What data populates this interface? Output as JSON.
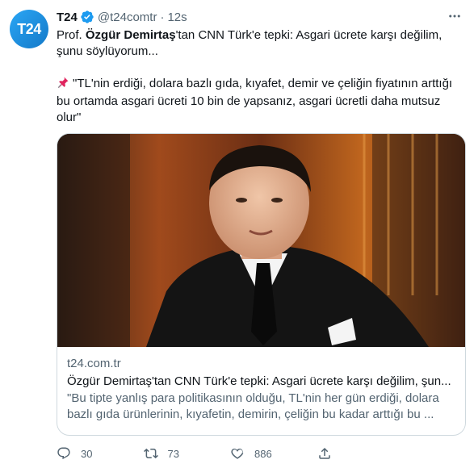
{
  "tweet": {
    "avatar_text": "T24",
    "display_name": "T24",
    "handle": "@t24comtr",
    "separator": "·",
    "time": "12s",
    "text_prefix": "Prof. ",
    "text_bold": "Özgür Demirtaş",
    "text_suffix": "'tan CNN Türk'e tepki: Asgari ücrete karşı değilim, şunu söylüyorum...",
    "quote": "\"TL'nin erdiği, dolara bazlı gıda, kıyafet, demir ve çeliğin fiyatının arttığı bu ortamda asgari ücreti 10 bin de yapsanız, asgari ücretli daha mutsuz olur\"",
    "icons": {
      "verified": "verified-badge-icon",
      "more": "more-icon",
      "pin": "pushpin-icon"
    }
  },
  "card": {
    "domain": "t24.com.tr",
    "title": "Özgür Demirtaş'tan CNN Türk'e tepki: Asgari ücrete karşı değilim, şun...",
    "description": "\"Bu tipte yanlış para politikasının olduğu, TL'nin her gün erdiği, dolara bazlı gıda ürünlerinin, kıyafetin, demirin, çeliğin bu kadar arttığı bu ..."
  },
  "actions": {
    "reply_count": "30",
    "retweet_count": "73",
    "like_count": "886"
  },
  "colors": {
    "accent": "#1d9bf0",
    "secondary_text": "#536471",
    "border": "#cfd9de"
  }
}
